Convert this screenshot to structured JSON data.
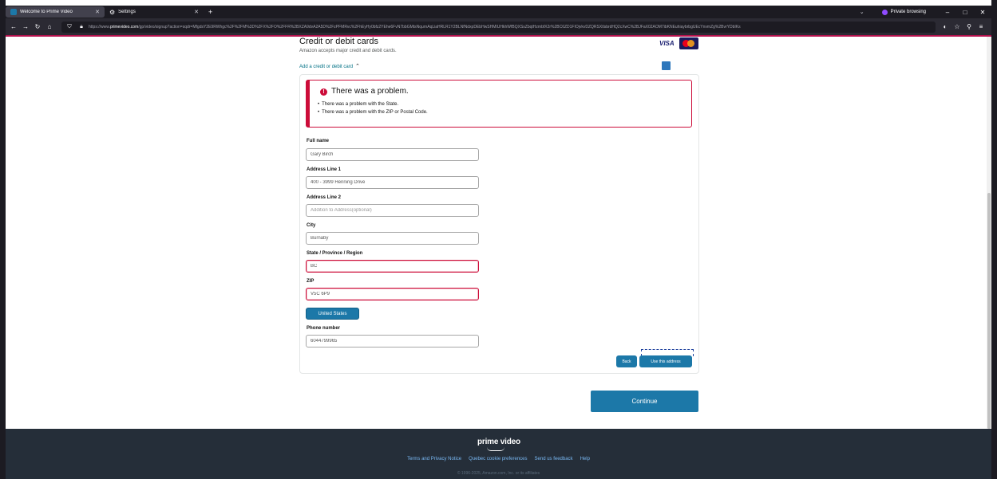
{
  "browser": {
    "tabs": [
      {
        "title": "Welcome to Prime Video",
        "active": true
      },
      {
        "title": "Settings",
        "active": false
      }
    ],
    "new_tab": "+",
    "private_label": "Private browsing",
    "url_prefix": "https://www.",
    "url_domain": "primevideo.com",
    "url_path": "/gp/video/signup?action=sqdr=MfgdsY2E9RWhgc%2F%2FM%3D%2FX%2FO%2FFR%2BXZA9dvA2A5D%2FzPFMRvc%2FhEyHy0bfz2YEhe6FvN7bbGMtsNqurnAqLiaHRLR1Y2BLNfNdxpDEbHwSHMIUHkhWfBQXSsZbqtHzmbfX2r%2BC6ZD1FIOjvkvDZQRSXtlsbrdHQ2cXwC%2BJFaX02AOM7ibKNEuhiaybrbgUEcYnvmZg%2BvrYDbIKs",
    "window_minimize": "–",
    "window_restore": "□",
    "window_close": "✕"
  },
  "payment": {
    "title": "Credit or debit cards",
    "subtitle": "Amazon accepts major credit and debit cards.",
    "add_card_link": "Add a credit or debit card",
    "card_logos": [
      "visa-logo",
      "mastercard-logo",
      "amex-logo"
    ],
    "visa_text": "VISA"
  },
  "alert": {
    "title": "There was a problem.",
    "icon": "!",
    "messages": [
      "There was a problem with the State.",
      "There was a problem with the ZIP or Postal Code."
    ]
  },
  "form": {
    "full_name": {
      "label": "Full name",
      "value": "Gary Birch"
    },
    "address1": {
      "label": "Address Line 1",
      "value": "400 - 3999 Henning Drive"
    },
    "address2": {
      "label": "Address Line 2",
      "value": "",
      "placeholder": "Addition to Address(optional)"
    },
    "city": {
      "label": "City",
      "value": "Burnaby"
    },
    "state": {
      "label": "State / Province / Region",
      "value": "BC",
      "error": true
    },
    "zip": {
      "label": "ZIP",
      "value": "V5C 6P9",
      "error": true
    },
    "country_button": "United States",
    "phone": {
      "label": "Phone number",
      "value": "6044799965"
    }
  },
  "actions": {
    "back": "Back",
    "use_address": "Use this address",
    "continue": "Continue"
  },
  "footer": {
    "logo_text": "prime video",
    "links": [
      "Terms and Privacy Notice",
      "Quebec cookie preferences",
      "Send us feedback",
      "Help"
    ],
    "copyright": "© 1996-2025, Amazon.com, Inc. or its affiliates"
  },
  "colors": {
    "accent": "#1c78a8",
    "error": "#cc0c39",
    "footer_bg": "#252e39",
    "private_purple": "#8f4bff"
  }
}
